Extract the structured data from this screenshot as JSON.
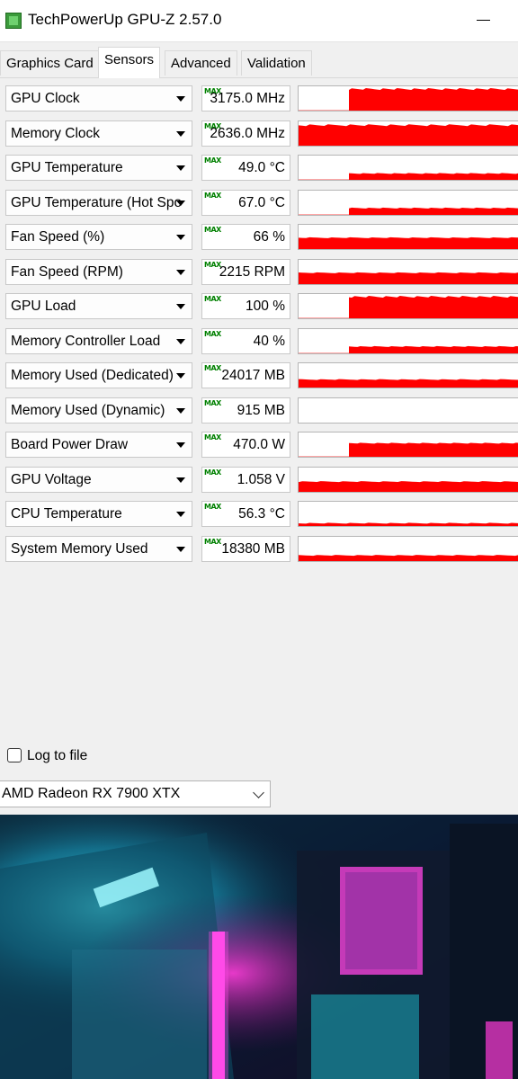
{
  "window": {
    "title": "TechPowerUp GPU-Z 2.57.0"
  },
  "tabs": [
    {
      "label": "Graphics Card",
      "active": false
    },
    {
      "label": "Sensors",
      "active": true
    },
    {
      "label": "Advanced",
      "active": false
    },
    {
      "label": "Validation",
      "active": false
    }
  ],
  "sensors": [
    {
      "name": "GPU Clock",
      "value": "3175.0 MHz",
      "max": "MAX",
      "history_level": 0.95,
      "active_from": 0.23
    },
    {
      "name": "Memory Clock",
      "value": "2636.0 MHz",
      "max": "MAX",
      "history_level": 0.9,
      "active_from": 0.0
    },
    {
      "name": "GPU Temperature",
      "value": "49.0 °C",
      "max": "MAX",
      "history_level": 0.28,
      "active_from": 0.23
    },
    {
      "name": "GPU Temperature (Hot Spot)",
      "value": "67.0 °C",
      "max": "MAX",
      "history_level": 0.3,
      "active_from": 0.23
    },
    {
      "name": "Fan Speed (%)",
      "value": "66 %",
      "max": "MAX",
      "history_level": 0.5,
      "active_from": 0.0
    },
    {
      "name": "Fan Speed (RPM)",
      "value": "2215 RPM",
      "max": "MAX",
      "history_level": 0.5,
      "active_from": 0.0
    },
    {
      "name": "GPU Load",
      "value": "100 %",
      "max": "MAX",
      "history_level": 0.95,
      "active_from": 0.23
    },
    {
      "name": "Memory Controller Load",
      "value": "40 %",
      "max": "MAX",
      "history_level": 0.3,
      "active_from": 0.23
    },
    {
      "name": "Memory Used (Dedicated)",
      "value": "24017 MB",
      "max": "MAX",
      "history_level": 0.35,
      "active_from": 0.0
    },
    {
      "name": "Memory Used (Dynamic)",
      "value": "915 MB",
      "max": "MAX",
      "history_level": 0.0,
      "active_from": 0.0
    },
    {
      "name": "Board Power Draw",
      "value": "470.0 W",
      "max": "MAX",
      "history_level": 0.6,
      "active_from": 0.23
    },
    {
      "name": "GPU Voltage",
      "value": "1.058 V",
      "max": "MAX",
      "history_level": 0.45,
      "active_from": 0.0
    },
    {
      "name": "CPU Temperature",
      "value": "56.3 °C",
      "max": "MAX",
      "history_level": 0.12,
      "active_from": 0.0
    },
    {
      "name": "System Memory Used",
      "value": "18380 MB",
      "max": "MAX",
      "history_level": 0.25,
      "active_from": 0.0
    }
  ],
  "log": {
    "label": "Log to file",
    "checked": false
  },
  "gpu_selector": {
    "selected": "AMD Radeon RX 7900 XTX"
  },
  "colors": {
    "graph_fill": "#ff0000",
    "max_tag": "#008000"
  }
}
